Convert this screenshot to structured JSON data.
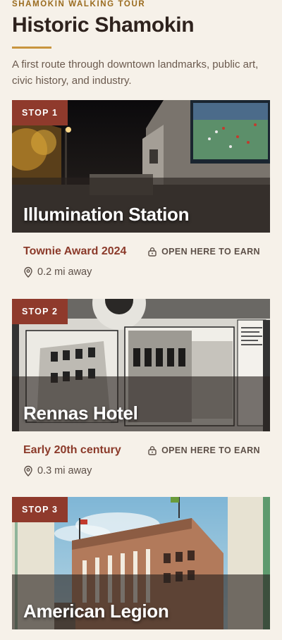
{
  "header": {
    "eyebrow": "SHAMOKIN WALKING TOUR",
    "title": "Historic Shamokin",
    "intro": "A first route through downtown landmarks, public art, civic history, and industry."
  },
  "stops": [
    {
      "badge": "STOP 1",
      "name": "Illumination Station",
      "subtitle": "Townie Award 2024",
      "earn_label": "OPEN HERE TO EARN",
      "distance": "0.2 mi away"
    },
    {
      "badge": "STOP 2",
      "name": "Rennas Hotel",
      "subtitle": "Early 20th century",
      "earn_label": "OPEN HERE TO EARN",
      "distance": "0.3 mi away"
    },
    {
      "badge": "STOP 3",
      "name": "American Legion"
    }
  ],
  "colors": {
    "background": "#f6f1e9",
    "badge": "#8f3a2c",
    "eyebrow": "#9a6b1e",
    "subtitle": "#8b3a2a"
  }
}
